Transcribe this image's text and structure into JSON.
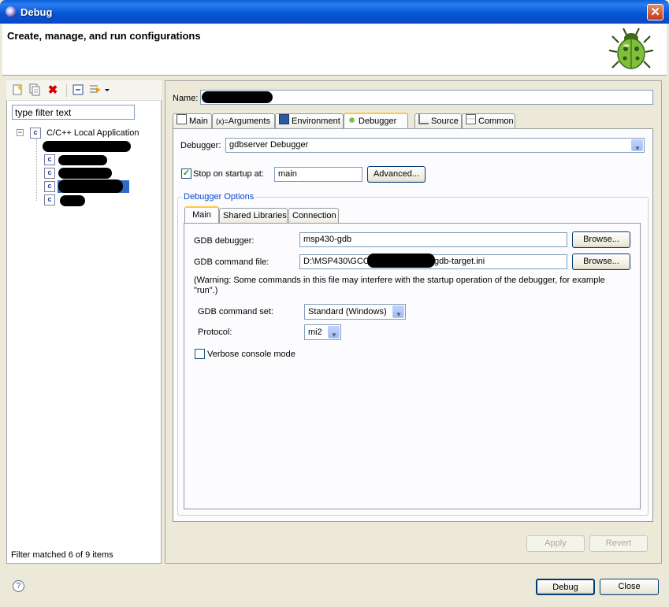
{
  "window": {
    "title": "Debug",
    "close_glyph": "✕"
  },
  "banner": {
    "title": "Create, manage, and run configurations",
    "icon": "bug-icon"
  },
  "left": {
    "toolbar": [
      "new-config-icon",
      "duplicate-icon",
      "delete-icon",
      "collapse-all-icon",
      "filter-icon"
    ],
    "filter_value": "type filter text",
    "tree": {
      "root_label": "C/C++ Local Application",
      "root_expander": "−",
      "item_icon_letter": "c"
    },
    "status": "Filter matched 6 of 9 items"
  },
  "config": {
    "name_label": "Name:",
    "tabs": [
      {
        "label": "Main",
        "icon": "main-tab-icon"
      },
      {
        "label": "Arguments",
        "icon": "arguments-tab-icon",
        "prefix": "(x)="
      },
      {
        "label": "Environment",
        "icon": "environment-tab-icon"
      },
      {
        "label": "Debugger",
        "icon": "debugger-tab-icon",
        "active": true
      },
      {
        "label": "Source",
        "icon": "source-tab-icon"
      },
      {
        "label": "Common",
        "icon": "common-tab-icon"
      }
    ],
    "debugger_label": "Debugger:",
    "debugger_value": "gdbserver Debugger",
    "stop_on_startup_label": "Stop on startup at:",
    "stop_on_startup_checked": true,
    "stop_on_startup_value": "main",
    "advanced_button": "Advanced...",
    "debugger_options_title": "Debugger Options",
    "sub_tabs": [
      {
        "label": "Main",
        "active": true
      },
      {
        "label": "Shared Libraries"
      },
      {
        "label": "Connection"
      }
    ],
    "gdb_debugger_label": "GDB debugger:",
    "gdb_debugger_value": "msp430-gdb",
    "browse_button": "Browse...",
    "gdb_command_file_label": "GDB command file:",
    "gdb_command_file_prefix": "D:\\MSP430\\GCC",
    "gdb_command_file_suffix": "gdb-target.ini",
    "warning": "(Warning: Some commands in this file may interfere with the startup operation of the debugger, for example \"run\".)",
    "gdb_command_set_label": "GDB command set:",
    "gdb_command_set_value": "Standard (Windows)",
    "protocol_label": "Protocol:",
    "protocol_value": "mi2",
    "verbose_label": "Verbose console mode",
    "verbose_checked": false,
    "apply_button": "Apply",
    "revert_button": "Revert"
  },
  "footer": {
    "help_glyph": "?",
    "debug_button": "Debug",
    "close_button": "Close"
  }
}
